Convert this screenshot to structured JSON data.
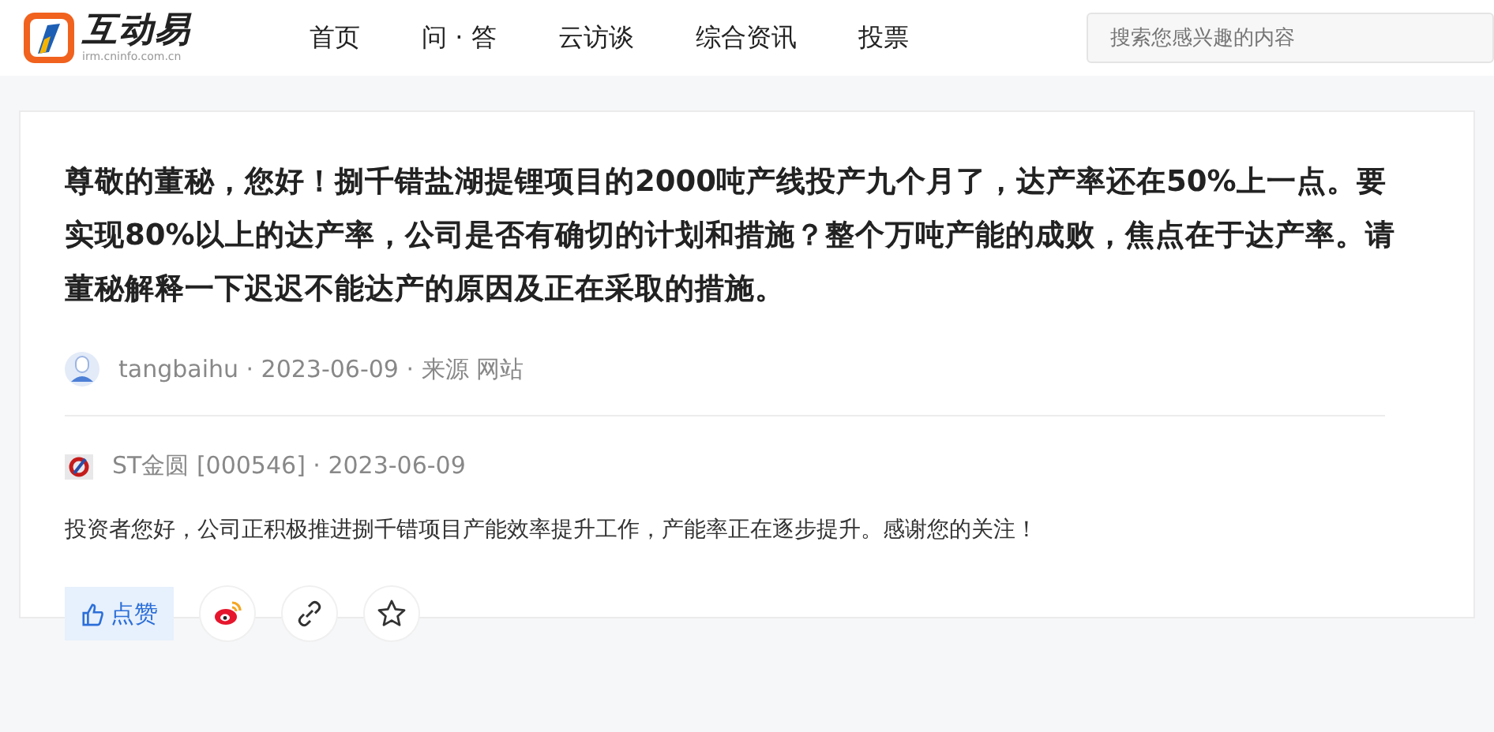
{
  "header": {
    "logo": {
      "name": "互动易",
      "url": "irm.cninfo.com.cn"
    },
    "nav": [
      {
        "label": "首页",
        "selected": false
      },
      {
        "label": "问 · 答",
        "selected": false
      },
      {
        "label": "云访谈",
        "selected": false
      },
      {
        "label": "综合资讯",
        "selected": false
      },
      {
        "label": "投票",
        "selected": false
      }
    ],
    "search": {
      "placeholder": "搜索您感兴趣的内容"
    }
  },
  "question": {
    "text": "尊敬的董秘，您好！捌千错盐湖提锂项目的2000吨产线投产九个月了，达产率还在50%上一点。要实现80%以上的达产率，公司是否有确切的计划和措施？整个万吨产能的成败，焦点在于达产率。请董秘解释一下迟迟不能达产的原因及正在采取的措施。",
    "author": "tangbaihu · 2023-06-09 · 来源 网站"
  },
  "answer": {
    "company": "ST金圆 [000546] · 2023-06-09",
    "text": "投资者您好，公司正积极推进捌千错项目产能效率提升工作，产能率正在逐步提升。感谢您的关注！"
  },
  "actions": {
    "like": {
      "label": "点赞",
      "selected": false
    },
    "buttons": [
      {
        "kind": "weibo"
      },
      {
        "kind": "link"
      },
      {
        "kind": "star"
      }
    ]
  }
}
